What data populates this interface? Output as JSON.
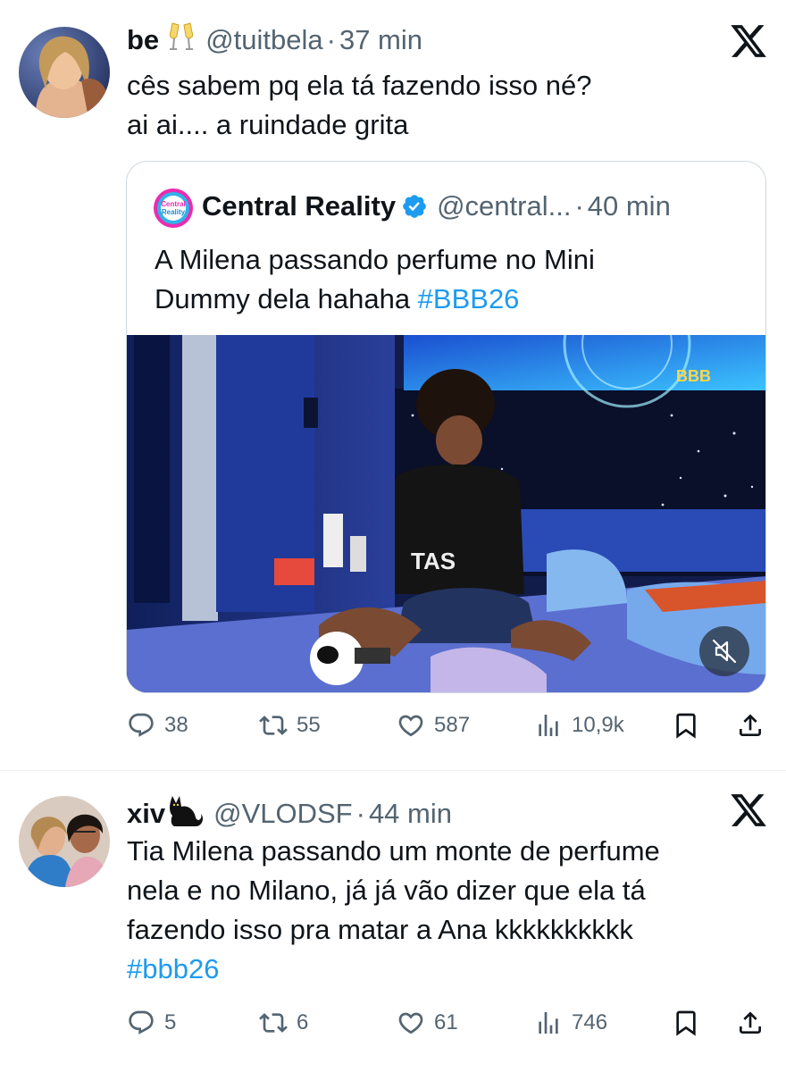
{
  "tweets": [
    {
      "display_name": "be",
      "name_emoji": "🥂",
      "handle": "@tuitbela",
      "separator": "·",
      "time": "37 min",
      "text_lines": [
        "cês sabem pq ela tá fazendo isso né?",
        "ai ai.... a ruindade grita"
      ],
      "quote": {
        "avatar_text": "Central Reality",
        "display_name": "Central Reality",
        "handle": "@central...",
        "separator": "·",
        "time": "40 min",
        "text_line1": "A Milena passando perfume no Mini",
        "text_line2_plain": "Dummy dela hahaha ",
        "text_line2_hashtag": "#BBB26",
        "media_logo": "BBB"
      },
      "actions": {
        "replies": "38",
        "reposts": "55",
        "likes": "587",
        "views": "10,9k"
      }
    },
    {
      "display_name": "xiv",
      "name_emoji": "🐈‍⬛",
      "handle": "@VLODSF",
      "separator": "·",
      "time": "44 min",
      "text_lines": [
        "Tia Milena passando um monte de perfume",
        "nela e no Milano, já já vão dizer que ela tá",
        "fazendo isso pra matar a Ana kkkkkkkkkk"
      ],
      "hashtag": "#bbb26",
      "actions": {
        "replies": "5",
        "reposts": "6",
        "likes": "61",
        "views": "746"
      }
    }
  ],
  "colors": {
    "link": "#1d9bf0",
    "muted": "#536471",
    "text": "#0f1419",
    "border": "#cfd9de"
  },
  "icons": [
    "x-logo-icon",
    "verified-badge-icon",
    "reply-icon",
    "repost-icon",
    "like-icon",
    "views-icon",
    "bookmark-icon",
    "share-icon",
    "mute-icon"
  ]
}
